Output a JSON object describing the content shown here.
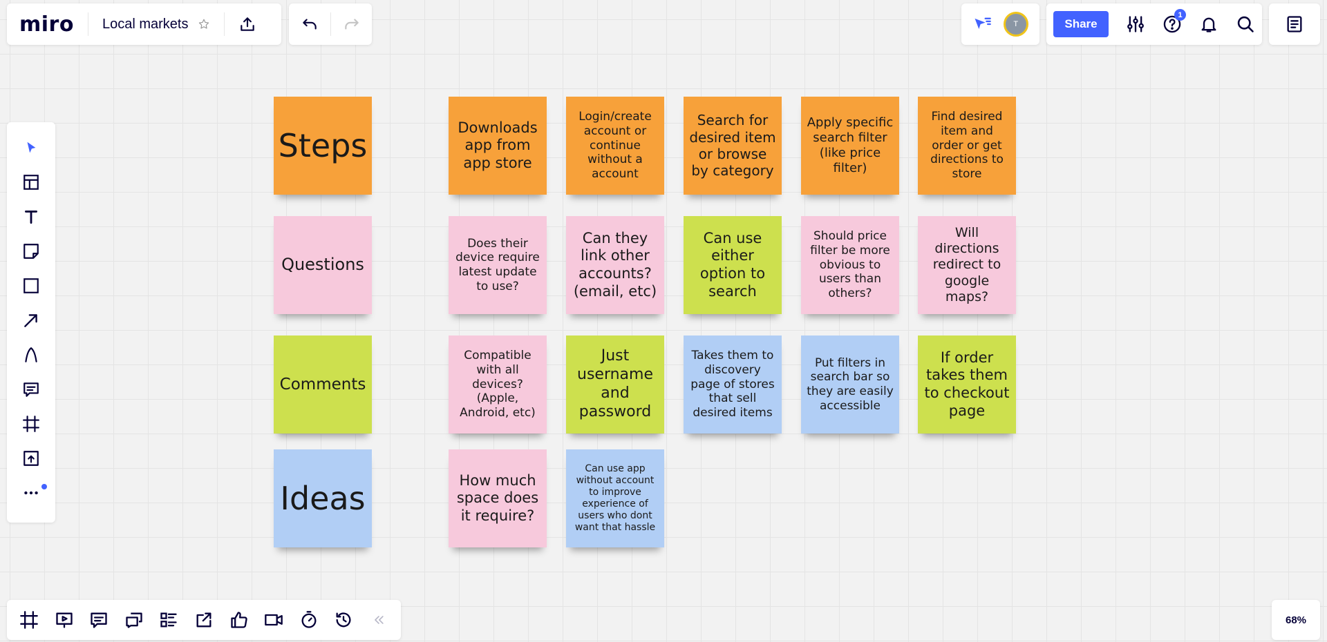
{
  "app": {
    "logo": "miro",
    "board_title": "Local markets"
  },
  "topbar": {
    "share_label": "Share",
    "help_badge": "1",
    "avatar_initial": "T"
  },
  "zoom": "68%",
  "colors": {
    "accent": "#4262ff",
    "orange": "#f7a13a",
    "pink": "#f7c9dc",
    "green": "#cde04e",
    "blue": "#b1cef5"
  },
  "left_toolbar": [
    "select-icon",
    "templates-icon",
    "text-icon",
    "sticky-note-icon",
    "shape-icon",
    "arrow-icon",
    "pen-icon",
    "comment-icon",
    "frame-icon",
    "upload-icon",
    "more-icon"
  ],
  "bottom_toolbar": [
    "frames-icon",
    "presentation-icon",
    "comments-icon",
    "video-chat-icon",
    "cards-icon",
    "share-screen-icon",
    "voting-icon",
    "video-icon",
    "timer-icon",
    "history-icon",
    "collapse-icon"
  ],
  "stickies": {
    "steps_header": "Steps",
    "questions_header": "Questions",
    "comments_header": "Comments",
    "ideas_header": "Ideas",
    "step1": "Downloads app from app store",
    "step2": "Login/create account or continue without a account",
    "step3": "Search for desired item or browse by category",
    "step4": "Apply specific search filter (like price filter)",
    "step5": "Find desired item and order or get directions to store",
    "question1": "Does their device require latest update to use?",
    "question2": "Can they link other accounts? (email, etc)",
    "question3": "Can use either option to search",
    "question4": "Should price filter be more obvious to users than others?",
    "question5": "Will directions redirect to google maps?",
    "comment1": "Compatible with all devices? (Apple, Android, etc)",
    "comment2": "Just username and password",
    "comment3": "Takes them to discovery page of stores that sell desired items",
    "comment4": "Put filters in search bar so they are easily accessible",
    "comment5": "If order takes them to checkout page",
    "idea1": "How much space does it require?",
    "idea2": "Can use app without account to improve experience of users who dont want that hassle"
  }
}
